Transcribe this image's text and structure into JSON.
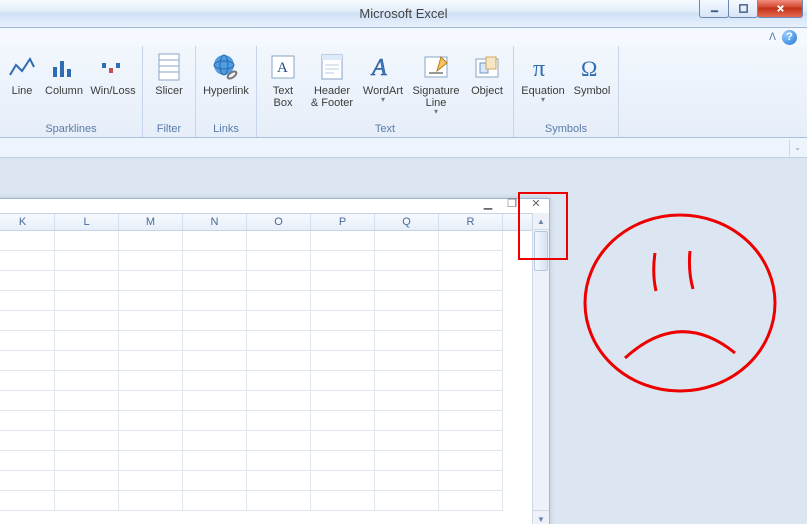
{
  "title": "Microsoft Excel",
  "ribbon": {
    "groups": {
      "sparklines": {
        "label": "Sparklines",
        "line": "Line",
        "column": "Column",
        "winloss": "Win/Loss"
      },
      "filter": {
        "label": "Filter",
        "slicer": "Slicer"
      },
      "links": {
        "label": "Links",
        "hyperlink": "Hyperlink"
      },
      "text": {
        "label": "Text",
        "textbox": "Text\nBox",
        "header": "Header\n& Footer",
        "wordart": "WordArt",
        "sigline": "Signature\nLine",
        "object": "Object"
      },
      "symbols": {
        "label": "Symbols",
        "equation": "Equation",
        "symbol": "Symbol"
      }
    }
  },
  "columns": [
    "K",
    "L",
    "M",
    "N",
    "O",
    "P",
    "Q",
    "R"
  ]
}
